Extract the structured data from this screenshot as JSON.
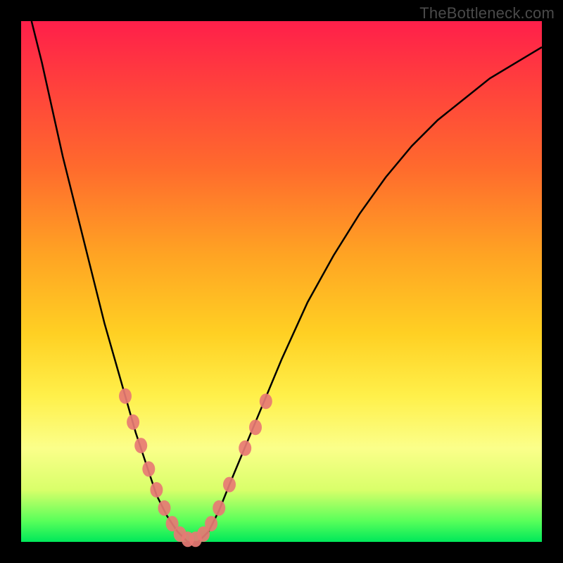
{
  "watermark": "TheBottleneck.com",
  "colors": {
    "background": "#000000",
    "gradient_top": "#ff1f4a",
    "gradient_mid1": "#ff6a2d",
    "gradient_mid2": "#ffd023",
    "gradient_mid3": "#fbff8a",
    "gradient_bottom": "#00e85a",
    "curve": "#000000",
    "markers": "#e77a74",
    "watermark_text": "#4a4a4a"
  },
  "chart_data": {
    "type": "line",
    "title": "",
    "xlabel": "",
    "ylabel": "",
    "xlim": [
      0,
      100
    ],
    "ylim": [
      0,
      100
    ],
    "grid": false,
    "series": [
      {
        "name": "curve",
        "x": [
          2,
          4,
          6,
          8,
          10,
          12,
          14,
          16,
          18,
          20,
          22,
          24,
          26,
          28,
          30,
          32,
          34,
          36,
          38,
          40,
          45,
          50,
          55,
          60,
          65,
          70,
          75,
          80,
          85,
          90,
          95,
          100
        ],
        "y": [
          100,
          92,
          83,
          74,
          66,
          58,
          50,
          42,
          35,
          28,
          21,
          15,
          9,
          5,
          2,
          0,
          0,
          2,
          6,
          11,
          23,
          35,
          46,
          55,
          63,
          70,
          76,
          81,
          85,
          89,
          92,
          95
        ]
      }
    ],
    "markers": [
      {
        "x": 20.0,
        "y": 28.0
      },
      {
        "x": 21.5,
        "y": 23.0
      },
      {
        "x": 23.0,
        "y": 18.5
      },
      {
        "x": 24.5,
        "y": 14.0
      },
      {
        "x": 26.0,
        "y": 10.0
      },
      {
        "x": 27.5,
        "y": 6.5
      },
      {
        "x": 29.0,
        "y": 3.5
      },
      {
        "x": 30.5,
        "y": 1.5
      },
      {
        "x": 32.0,
        "y": 0.5
      },
      {
        "x": 33.5,
        "y": 0.5
      },
      {
        "x": 35.0,
        "y": 1.5
      },
      {
        "x": 36.5,
        "y": 3.5
      },
      {
        "x": 38.0,
        "y": 6.5
      },
      {
        "x": 40.0,
        "y": 11.0
      },
      {
        "x": 43.0,
        "y": 18.0
      },
      {
        "x": 45.0,
        "y": 22.0
      },
      {
        "x": 47.0,
        "y": 27.0
      }
    ]
  }
}
